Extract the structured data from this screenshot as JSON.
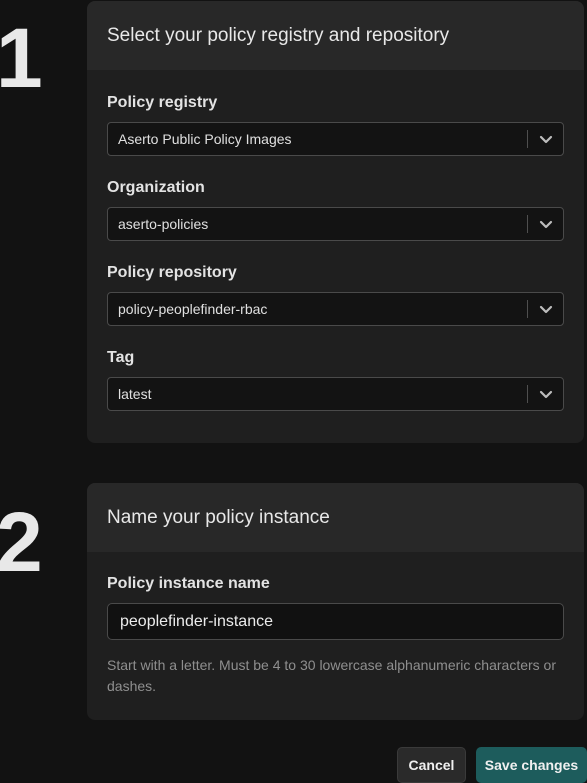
{
  "steps": [
    {
      "number": "1",
      "title": "Select your policy registry and repository",
      "fields": [
        {
          "label": "Policy registry",
          "value": "Aserto Public Policy Images",
          "icon": "chevron-down-icon"
        },
        {
          "label": "Organization",
          "value": "aserto-policies",
          "icon": "chevron-down-icon"
        },
        {
          "label": "Policy repository",
          "value": "policy-peoplefinder-rbac",
          "icon": "chevron-down-icon"
        },
        {
          "label": "Tag",
          "value": "latest",
          "icon": "chevron-down-icon"
        }
      ]
    },
    {
      "number": "2",
      "title": "Name your policy instance",
      "field": {
        "label": "Policy instance name",
        "value": "peoplefinder-instance",
        "hint": "Start with a letter. Must be 4 to 30 lowercase alphanumeric characters or dashes."
      }
    }
  ],
  "actions": {
    "cancel_label": "Cancel",
    "save_label": "Save changes"
  },
  "colors": {
    "background": "#121212",
    "card": "#1f1f1f",
    "card_header": "#282828",
    "primary_button": "#1d5c5c"
  }
}
